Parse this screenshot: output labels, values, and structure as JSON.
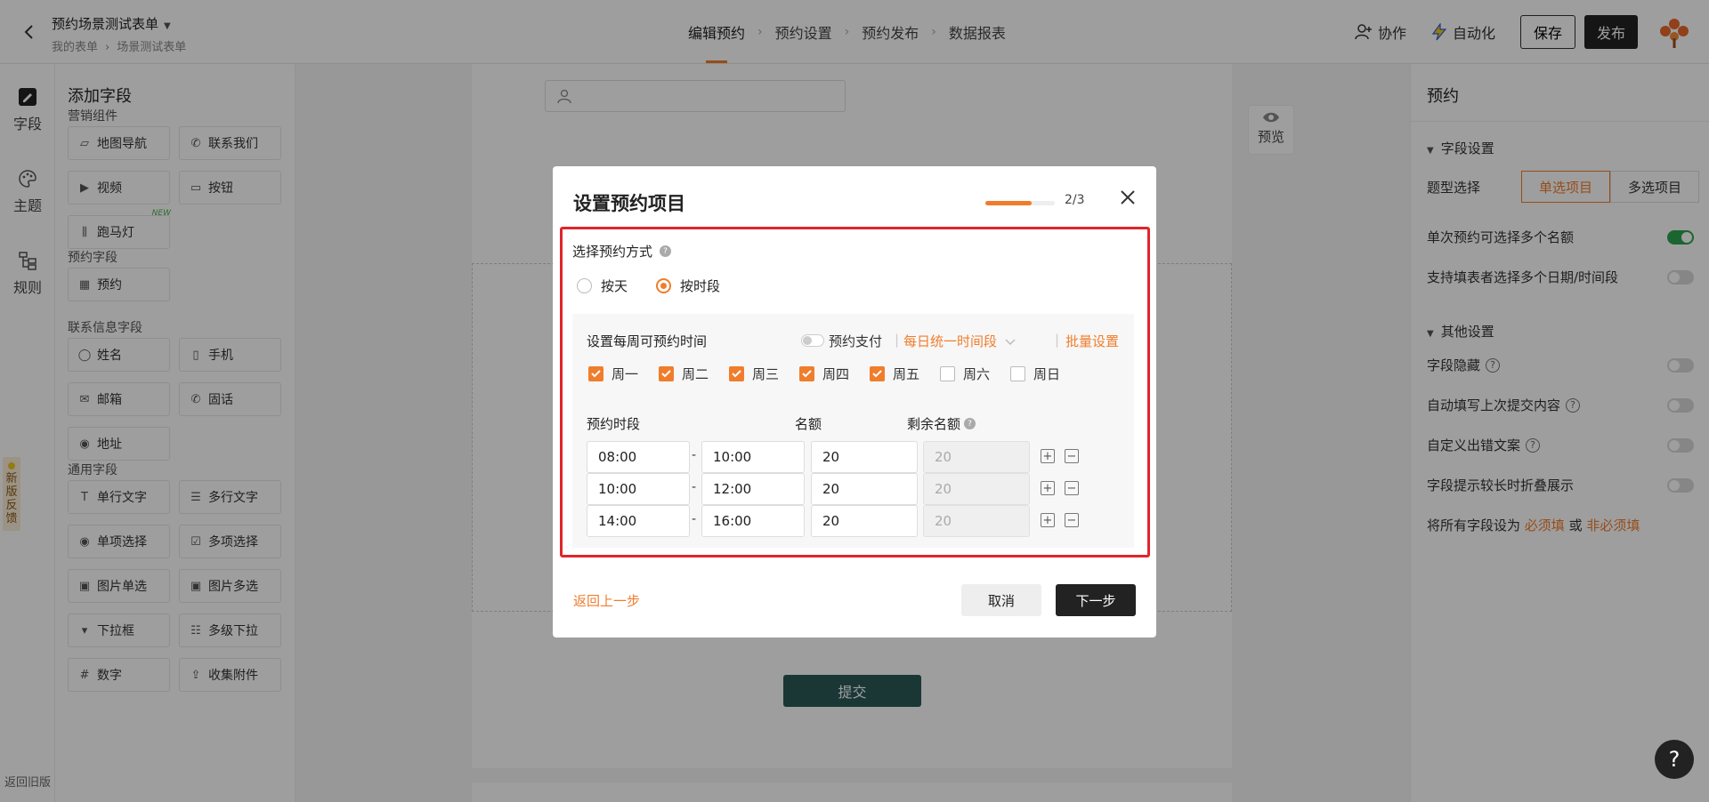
{
  "header": {
    "form_title": "预约场景测试表单",
    "breadcrumb": [
      "我的表单",
      "场景测试表单"
    ],
    "steps": [
      "编辑预约",
      "预约设置",
      "预约发布",
      "数据报表"
    ],
    "collab_label": "协作",
    "auto_label": "自动化",
    "save_label": "保存",
    "publish_label": "发布"
  },
  "rail": {
    "items": [
      "字段",
      "主题",
      "规则"
    ],
    "feedback": "新版反馈",
    "old_version": "返回旧版"
  },
  "fields_panel": {
    "title": "添加字段",
    "groups": [
      {
        "title": "营销组件",
        "items": [
          {
            "label": "地图导航",
            "icon": "map-icon"
          },
          {
            "label": "联系我们",
            "icon": "phone-icon"
          },
          {
            "label": "视频",
            "icon": "video-icon"
          },
          {
            "label": "按钮",
            "icon": "button-icon"
          },
          {
            "label": "跑马灯",
            "icon": "marquee-icon",
            "badge": "NEW"
          }
        ]
      },
      {
        "title": "预约字段",
        "items": [
          {
            "label": "预约",
            "icon": "calendar-icon"
          }
        ]
      },
      {
        "title": "联系信息字段",
        "items": [
          {
            "label": "姓名",
            "icon": "user-icon"
          },
          {
            "label": "手机",
            "icon": "mobile-icon"
          },
          {
            "label": "邮箱",
            "icon": "mail-icon"
          },
          {
            "label": "固话",
            "icon": "phone-icon"
          },
          {
            "label": "地址",
            "icon": "location-icon"
          }
        ]
      },
      {
        "title": "通用字段",
        "items": [
          {
            "label": "单行文字",
            "icon": "text-icon"
          },
          {
            "label": "多行文字",
            "icon": "textarea-icon"
          },
          {
            "label": "单项选择",
            "icon": "radio-icon"
          },
          {
            "label": "多项选择",
            "icon": "checkbox-icon"
          },
          {
            "label": "图片单选",
            "icon": "image-icon"
          },
          {
            "label": "图片多选",
            "icon": "image-icon"
          },
          {
            "label": "下拉框",
            "icon": "dropdown-icon"
          },
          {
            "label": "多级下拉",
            "icon": "cascade-icon"
          },
          {
            "label": "数字",
            "icon": "number-icon"
          },
          {
            "label": "收集附件",
            "icon": "upload-icon"
          }
        ]
      }
    ]
  },
  "canvas": {
    "preview_label": "预览",
    "submit_label": "提交"
  },
  "settings": {
    "title": "预约",
    "field_settings": "字段设置",
    "type_label": "题型选择",
    "type_options": [
      "单选项目",
      "多选项目"
    ],
    "type_selected": "单选项目",
    "multi_quota": "单次预约可选择多个名额",
    "multi_quota_on": true,
    "multi_date": "支持填表者选择多个日期/时间段",
    "multi_date_on": false,
    "other_settings": "其他设置",
    "hide_field": "字段隐藏",
    "auto_fill": "自动填写上次提交内容",
    "custom_error": "自定义出错文案",
    "fold_hint": "字段提示较长时折叠展示",
    "required_text_prefix": "将所有字段设为",
    "required_link": "必须填",
    "required_or": "或",
    "optional_link": "非必须填"
  },
  "modal": {
    "title": "设置预约项目",
    "progress_text": "2/3",
    "progress_fraction": 0.6667,
    "mode_label": "选择预约方式",
    "mode_options": [
      "按天",
      "按时段"
    ],
    "mode_selected": "按时段",
    "week_title": "设置每周可预约时间",
    "pay_label": "预约支付",
    "same_time_label": "每日统一时间段",
    "batch_label": "批量设置",
    "days": [
      {
        "label": "周一",
        "checked": true
      },
      {
        "label": "周二",
        "checked": true
      },
      {
        "label": "周三",
        "checked": true
      },
      {
        "label": "周四",
        "checked": true
      },
      {
        "label": "周五",
        "checked": true
      },
      {
        "label": "周六",
        "checked": false
      },
      {
        "label": "周日",
        "checked": false
      }
    ],
    "col_slot": "预约时段",
    "col_quota": "名额",
    "col_remaining": "剩余名额",
    "slots": [
      {
        "start": "08:00",
        "end": "10:00",
        "quota": "20",
        "remaining": "20"
      },
      {
        "start": "10:00",
        "end": "12:00",
        "quota": "20",
        "remaining": "20"
      },
      {
        "start": "14:00",
        "end": "16:00",
        "quota": "20",
        "remaining": "20"
      }
    ],
    "back_label": "返回上一步",
    "cancel_label": "取消",
    "next_label": "下一步"
  },
  "colors": {
    "accent": "#f07d2c",
    "dark": "#222222",
    "highlight": "#e0252a",
    "submit": "#2a5a57"
  }
}
